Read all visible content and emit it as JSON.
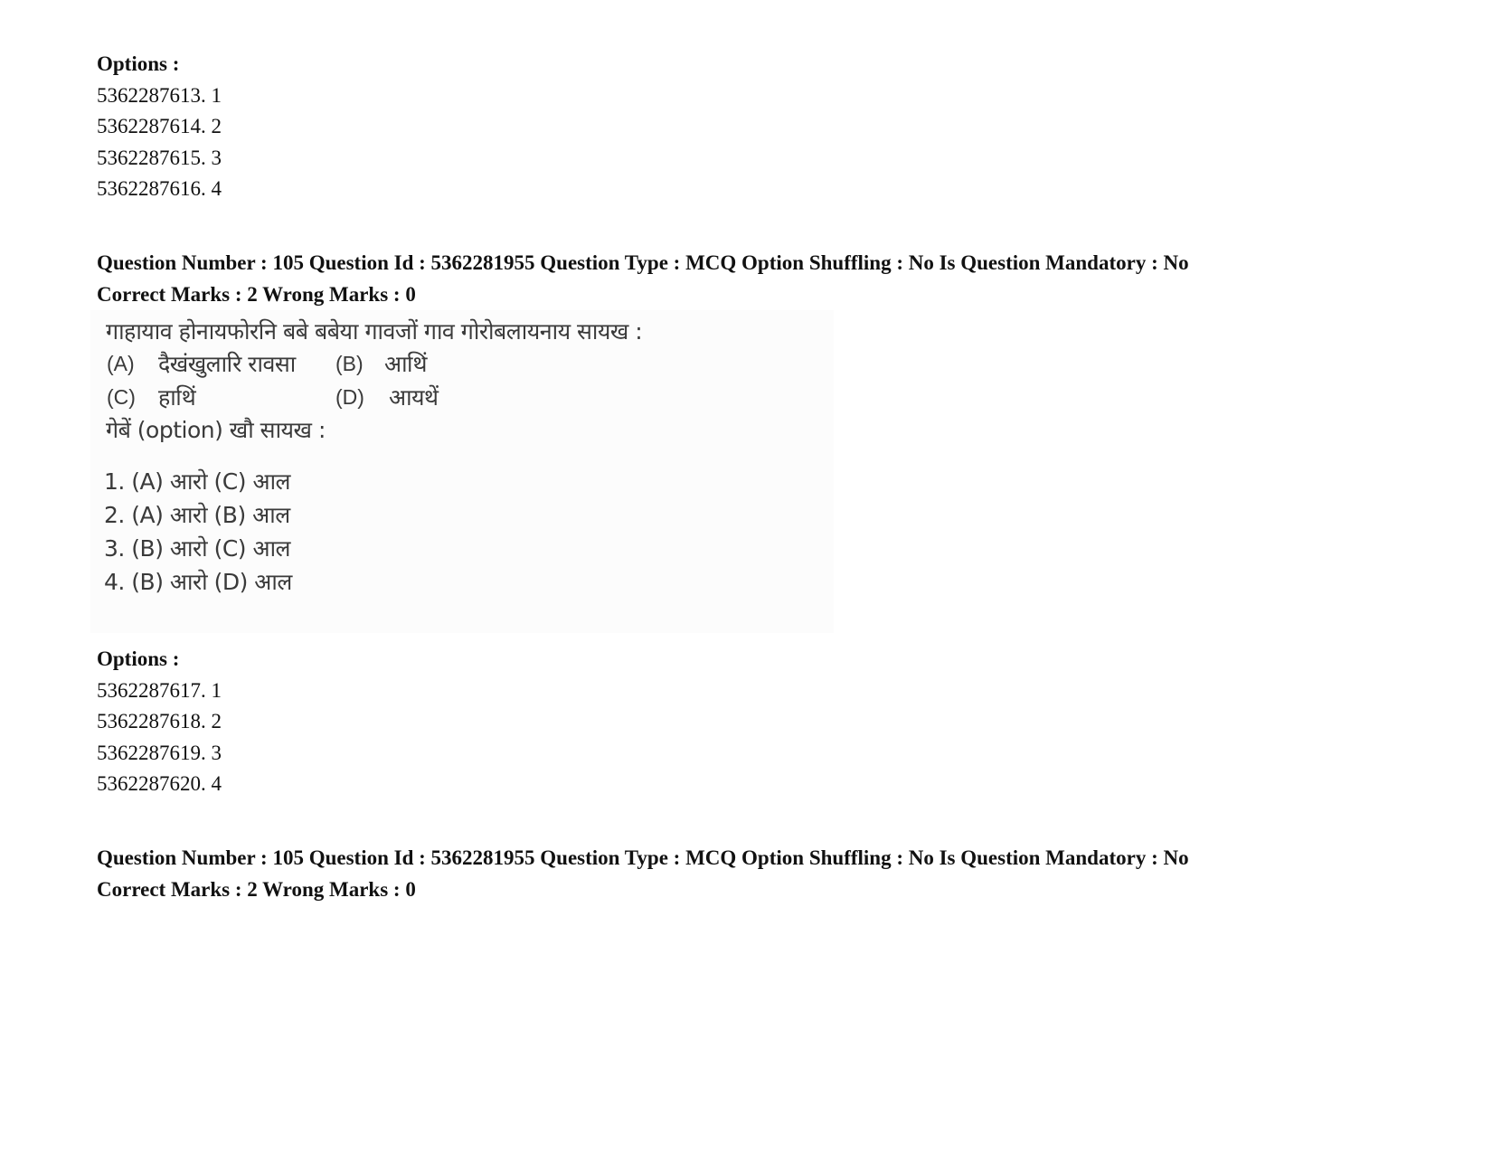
{
  "options_block_1": {
    "heading": "Options :",
    "options": [
      {
        "id": "5362287613",
        "label": "5362287613. 1"
      },
      {
        "id": "5362287614",
        "label": "5362287614. 2"
      },
      {
        "id": "5362287615",
        "label": "5362287615. 3"
      },
      {
        "id": "5362287616",
        "label": "5362287616. 4"
      }
    ]
  },
  "question_1": {
    "header_line": "Question Number : 105 Question Id : 5362281955 Question Type : MCQ Option Shuffling : No Is Question Mandatory : No",
    "marks_line": "Correct Marks : 2 Wrong Marks : 0",
    "question_number": "105",
    "question_id": "5362281955",
    "question_type": "MCQ",
    "option_shuffling": "No",
    "mandatory": "No",
    "correct_marks": "2",
    "wrong_marks": "0",
    "image": {
      "stem": "गाहायाव होनायफोरनि बबे बबेया गावजों गाव गोरोबलायनाय सायख :",
      "items": [
        {
          "label": "(A)",
          "text": "दैखंखुलारि रावसा"
        },
        {
          "label": "(B)",
          "text": "आथिं"
        },
        {
          "label": "(C)",
          "text": "हाथिं"
        },
        {
          "label": "(D)",
          "text": "आयथें"
        }
      ],
      "choose_line": "गेबें (option) खौ सायख :",
      "choices": [
        "1. (A) आरो (C) आल",
        "2. (A) आरो (B) आल",
        "3. (B) आरो (C) आल",
        "4. (B) आरो (D) आल"
      ]
    }
  },
  "options_block_2": {
    "heading": "Options :",
    "options": [
      {
        "id": "5362287617",
        "label": "5362287617. 1"
      },
      {
        "id": "5362287618",
        "label": "5362287618. 2"
      },
      {
        "id": "5362287619",
        "label": "5362287619. 3"
      },
      {
        "id": "5362287620",
        "label": "5362287620. 4"
      }
    ]
  },
  "question_2": {
    "header_line": "Question Number : 105 Question Id : 5362281955 Question Type : MCQ Option Shuffling : No Is Question Mandatory : No",
    "marks_line": "Correct Marks : 2 Wrong Marks : 0"
  }
}
